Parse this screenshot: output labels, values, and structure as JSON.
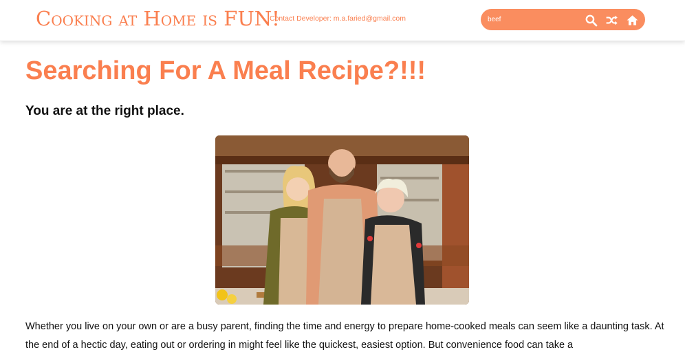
{
  "header": {
    "brand": "Cooking at Home is FUN!",
    "contact": "Contact Developer: m.a.faried@gmail.com",
    "search": {
      "value": "beef",
      "placeholder": "Search"
    },
    "icons": [
      "search-icon",
      "shuffle-icon",
      "home-icon"
    ]
  },
  "main": {
    "title": "Searching For A Meal Recipe?!!!",
    "subtitle": "You are at the right place.",
    "paragraph": "Whether you live on your own or are a busy parent, finding the time and energy to prepare home-cooked meals can seem like a daunting task. At the end of a hectic day, eating out or ordering in might feel like the quickest, easiest option. But convenience food can take a"
  },
  "colors": {
    "accent": "#fa7f4f",
    "search_bg": "#fa8d5f"
  }
}
